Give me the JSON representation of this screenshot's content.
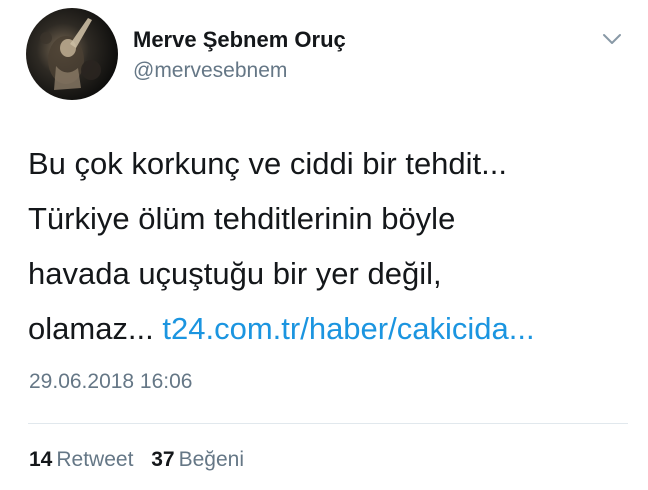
{
  "author": {
    "name": "Merve Şebnem Oruç",
    "handle": "@mervesebnem"
  },
  "menu": {
    "icon": "chevron-down-icon"
  },
  "tweet": {
    "lines": [
      "Bu çok korkunç ve ciddi bir tehdit...",
      "Türkiye ölüm tehditlerinin böyle",
      "havada uçuştuğu bir yer değil,"
    ],
    "last_line_text": "olamaz... ",
    "link_text": "t24.com.tr/haber/cakicida..."
  },
  "timestamp": "29.06.2018 16:06",
  "stats": {
    "retweets": {
      "count": "14",
      "label": "Retweet"
    },
    "likes": {
      "count": "37",
      "label": "Beğeni"
    }
  },
  "colors": {
    "link": "#1b95e0",
    "secondary_text": "#657786",
    "primary_text": "#14171a",
    "divider": "#e1e8ed"
  }
}
